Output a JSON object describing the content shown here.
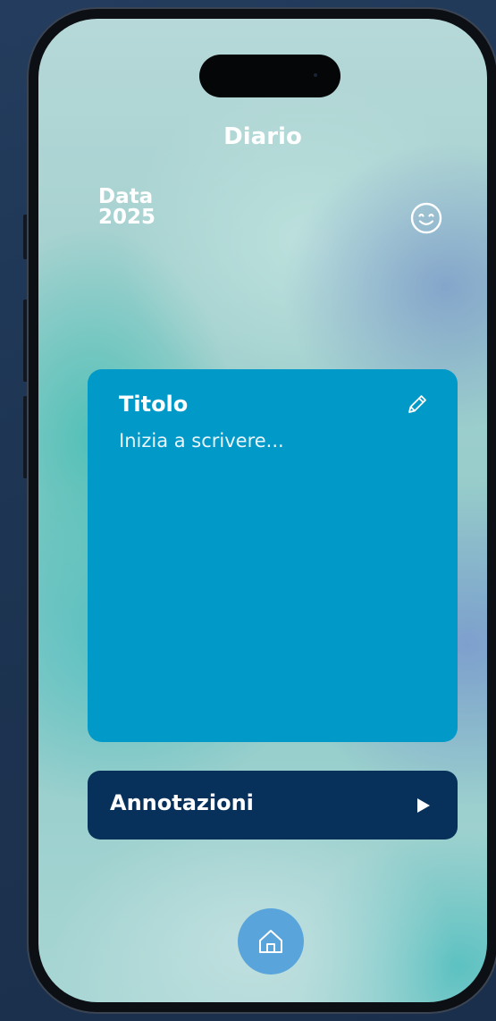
{
  "header": {
    "title": "Diario"
  },
  "date": {
    "line1": "Data",
    "line2": "2025"
  },
  "mood": {
    "icon": "smiley-icon"
  },
  "note_card": {
    "title": "Titolo",
    "placeholder": "Inizia a scrivere...",
    "edit_icon": "pencil-icon",
    "color": "#0099c8"
  },
  "annotations_button": {
    "label": "Annotazioni",
    "icon": "play-arrow-icon",
    "color": "#07305a"
  },
  "bottom_nav": {
    "home_icon": "home-icon",
    "color": "#5aa4dc"
  }
}
